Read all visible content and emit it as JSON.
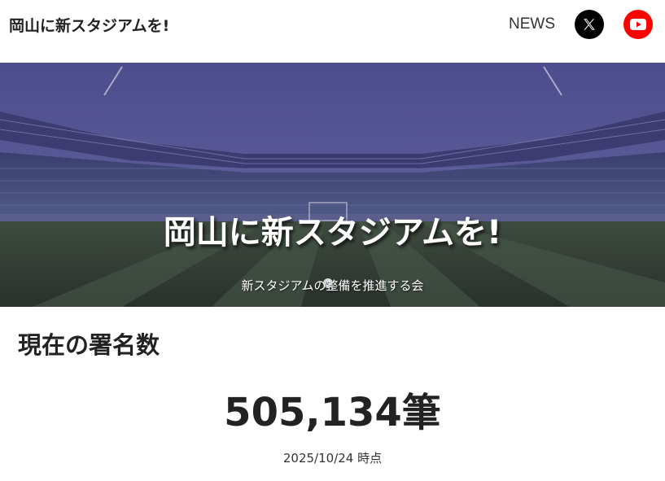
{
  "header": {
    "site_title": "岡山に新スタジアムを!",
    "nav_news": "NEWS",
    "x_icon": "x-logo-icon",
    "youtube_icon": "youtube-play-icon"
  },
  "hero": {
    "title": "岡山に新スタジアムを!",
    "subtitle": "新スタジアムの整備を推進する会",
    "background": "stadium-photo",
    "overlay_color": "#2a2a6e"
  },
  "signatures": {
    "heading": "現在の署名数",
    "count": "505,134筆",
    "as_of": "2025/10/24 時点"
  },
  "colors": {
    "x_button": "#000000",
    "youtube_button": "#ff0000",
    "text": "#222222"
  }
}
